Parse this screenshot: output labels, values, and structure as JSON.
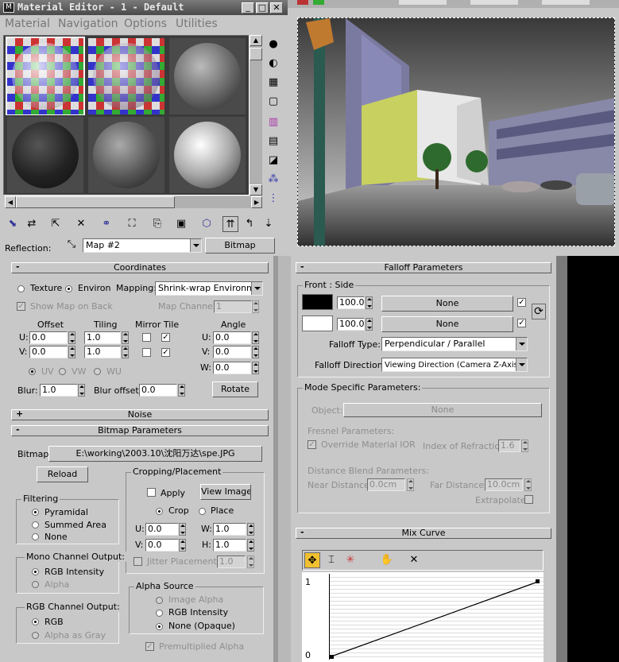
{
  "window": {
    "title": "Material Editor - 1 - Default"
  },
  "menu": [
    "Material",
    "Navigation",
    "Options",
    "Utilities"
  ],
  "reflection": {
    "label": "Reflection:",
    "map": "Map #2",
    "type": "Bitmap"
  },
  "rollouts": {
    "coordinates": "Coordinates",
    "noise": "Noise",
    "bitmap_params": "Bitmap Parameters",
    "falloff": "Falloff Parameters",
    "mix_curve": "Mix Curve"
  },
  "coords": {
    "texture": "Texture",
    "environ": "Environ",
    "mapping_label": "Mapping:",
    "mapping": "Shrink-wrap Environment",
    "show_map": "Show Map on Back",
    "map_channel_label": "Map Channel:",
    "map_channel": "1",
    "offset": "Offset",
    "tiling": "Tiling",
    "mirror_tile": "Mirror Tile",
    "angle": "Angle",
    "u": "U:",
    "v": "V:",
    "w": "W:",
    "u_offset": "0.0",
    "v_offset": "0.0",
    "u_tiling": "1.0",
    "v_tiling": "1.0",
    "u_angle": "0.0",
    "v_angle": "0.0",
    "w_angle": "0.0",
    "uv": "UV",
    "vw": "VW",
    "wu": "WU",
    "blur_label": "Blur:",
    "blur": "1.0",
    "blur_offset_label": "Blur offset:",
    "blur_offset": "0.0",
    "rotate": "Rotate"
  },
  "bitmap": {
    "label": "Bitmap:",
    "path": "E:\\working\\2003.10\\沈阳万达\\spe.JPG",
    "reload": "Reload",
    "cropping": "Cropping/Placement",
    "apply": "Apply",
    "view_image": "View Image",
    "crop": "Crop",
    "place": "Place",
    "u": "U:",
    "v": "V:",
    "w": "W:",
    "h": "H:",
    "u_val": "0.0",
    "v_val": "0.0",
    "w_val": "1.0",
    "h_val": "1.0",
    "jitter": "Jitter Placement:",
    "jitter_val": "1.0",
    "filtering": "Filtering",
    "pyramidal": "Pyramidal",
    "summed": "Summed Area",
    "none": "None",
    "mono": "Mono Channel Output:",
    "rgb_int": "RGB Intensity",
    "alpha": "Alpha",
    "rgb_out": "RGB Channel Output:",
    "rgb": "RGB",
    "alpha_gray": "Alpha as Gray",
    "alpha_source": "Alpha Source",
    "image_alpha": "Image Alpha",
    "rgb_int2": "RGB Intensity",
    "none_opaque": "None (Opaque)",
    "premult": "Premultiplied Alpha"
  },
  "falloff": {
    "front_side": "Front : Side",
    "amt1": "100.0",
    "amt2": "100.0",
    "map1": "None",
    "map2": "None",
    "type_label": "Falloff Type:",
    "type": "Perpendicular / Parallel",
    "dir_label": "Falloff Direction:",
    "dir": "Viewing Direction (Camera Z-Axis)",
    "mode": "Mode Specific Parameters:",
    "object_label": "Object:",
    "object": "None",
    "fresnel": "Fresnel Parameters:",
    "override_ior": "Override Material IOR",
    "ior_label": "Index of Refraction",
    "ior": "1.6",
    "distance": "Distance Blend Parameters:",
    "near_label": "Near Distance:",
    "near": "0.0cm",
    "far_label": "Far Distance:",
    "far": "10.0cm",
    "extrapolate": "Extrapolate"
  },
  "curve": {
    "y_top": "1",
    "y_bottom": "0"
  },
  "colors": {
    "panel": "#c8c8c8",
    "title_bar": "#5a5a5a",
    "dark": "#000000"
  }
}
